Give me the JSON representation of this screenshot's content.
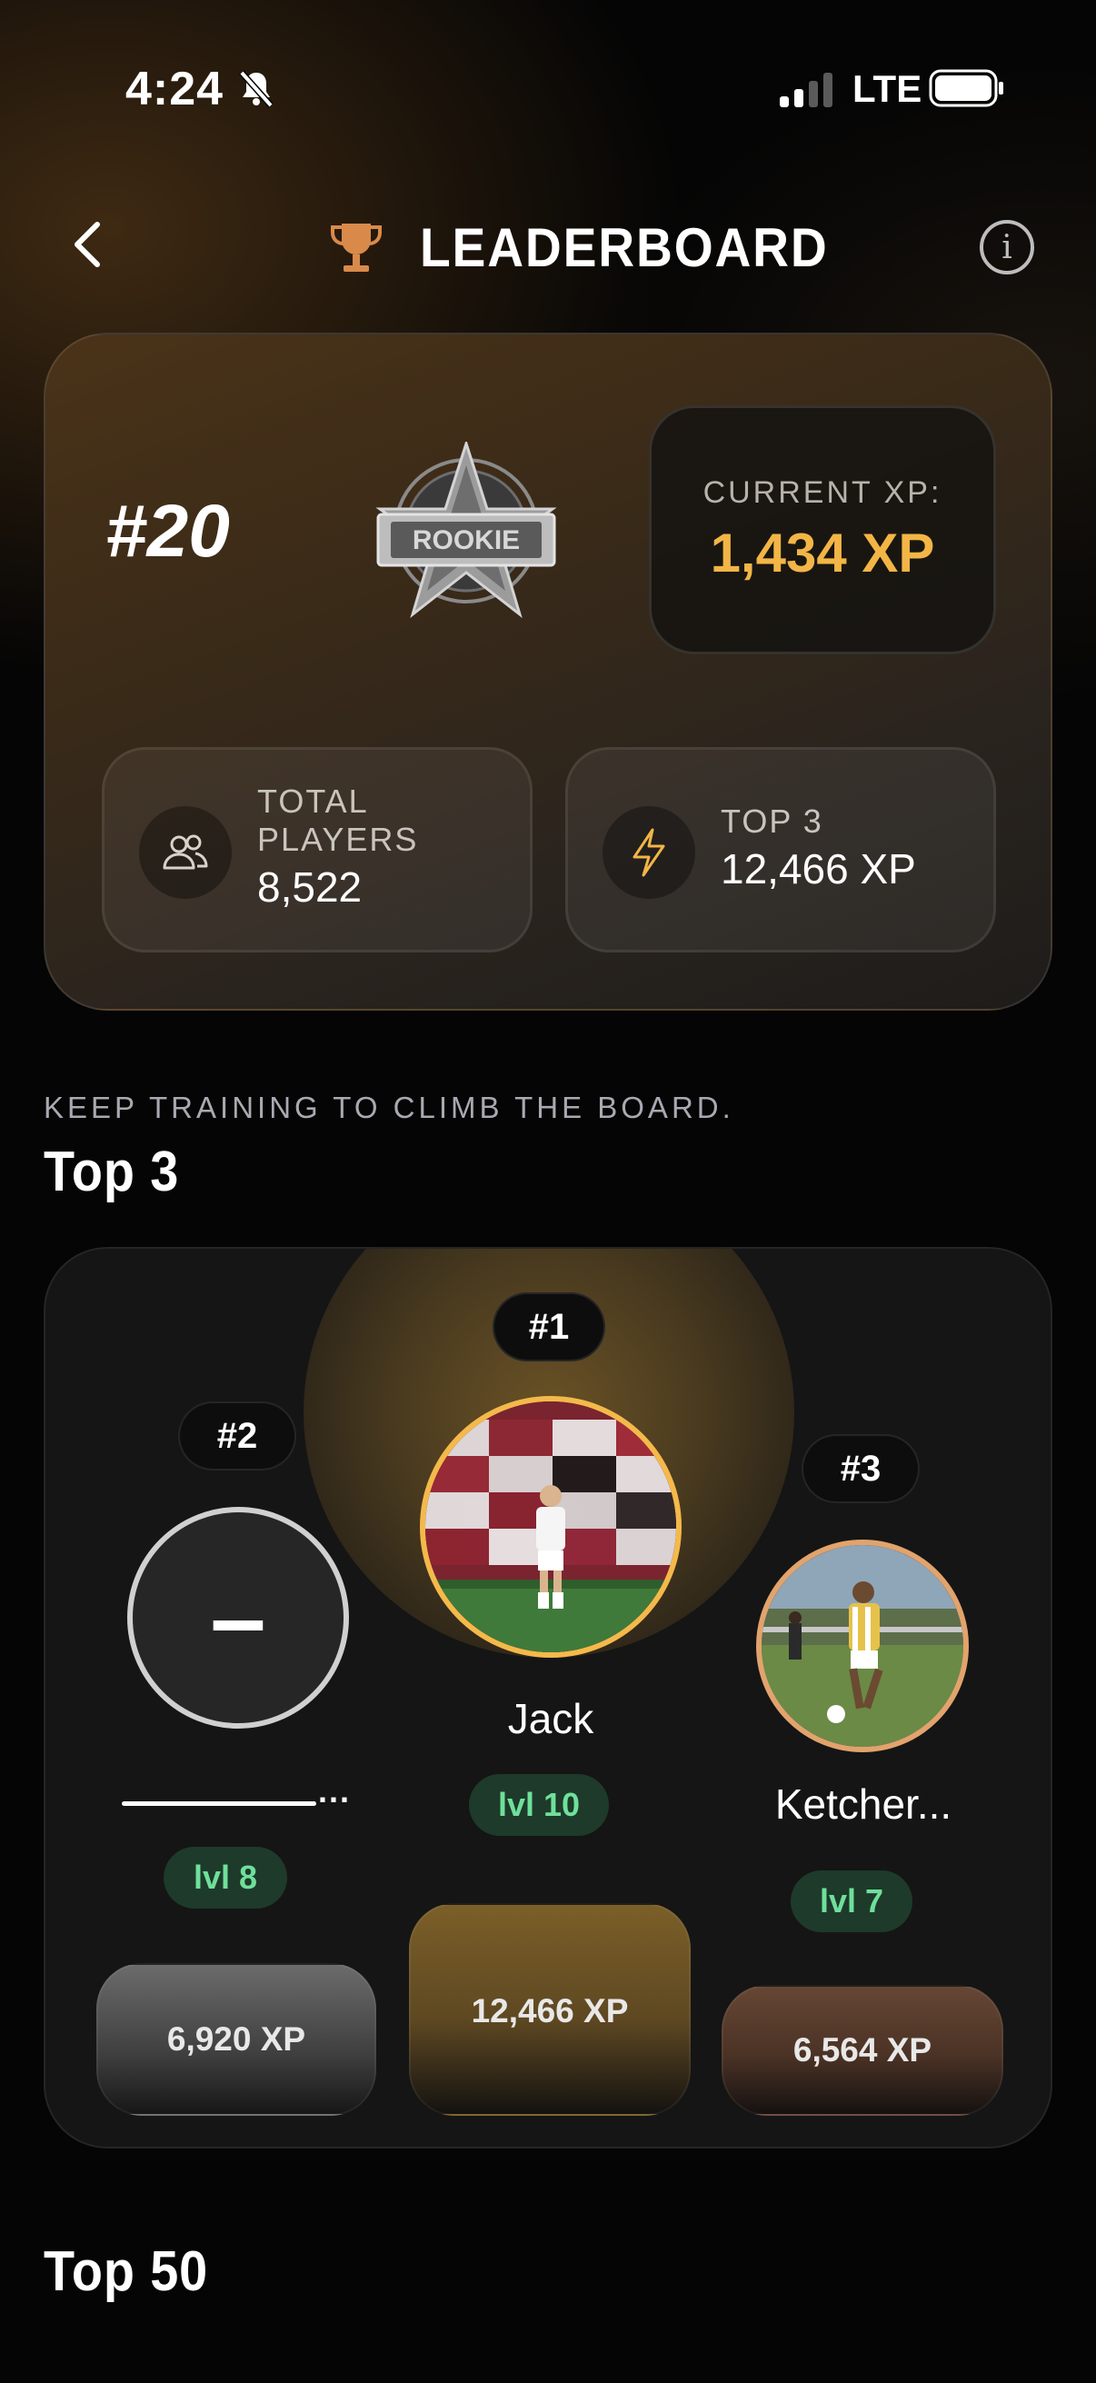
{
  "status_bar": {
    "time": "4:24",
    "network": "LTE",
    "icons": [
      "bell-off-icon",
      "signal-icon",
      "battery-icon"
    ]
  },
  "header": {
    "title": "LEADERBOARD",
    "icons": [
      "chevron-left-icon",
      "trophy-icon",
      "info-icon"
    ],
    "info_glyph": "i"
  },
  "rank_card": {
    "rank": "#20",
    "badge_text": "ROOKIE",
    "current_xp_label": "CURRENT XP:",
    "current_xp_value": "1,434 XP",
    "total_players_label": "TOTAL PLAYERS",
    "total_players_value": "8,522",
    "top3_label": "TOP 3",
    "top3_value": "12,466 XP",
    "stat_icons": [
      "users-icon",
      "lightning-icon"
    ]
  },
  "top3_section": {
    "subtitle": "KEEP TRAINING TO CLIMB THE BOARD.",
    "title": "Top 3"
  },
  "podium": {
    "second": {
      "rank": "#2",
      "avatar_initial": "–",
      "name_suffix": "...",
      "level": "lvl 8",
      "xp": "6,920 XP"
    },
    "first": {
      "rank": "#1",
      "name": "Jack",
      "level": "lvl 10",
      "xp": "12,466 XP"
    },
    "third": {
      "rank": "#3",
      "name": "Ketcher...",
      "level": "lvl 7",
      "xp": "6,564 XP"
    }
  },
  "top50_section": {
    "title": "Top 50"
  },
  "colors": {
    "accent_gold": "#f2b546",
    "level_green": "#6fe09b",
    "level_bg": "#1e3a2a",
    "trophy": "#d98a4a"
  }
}
